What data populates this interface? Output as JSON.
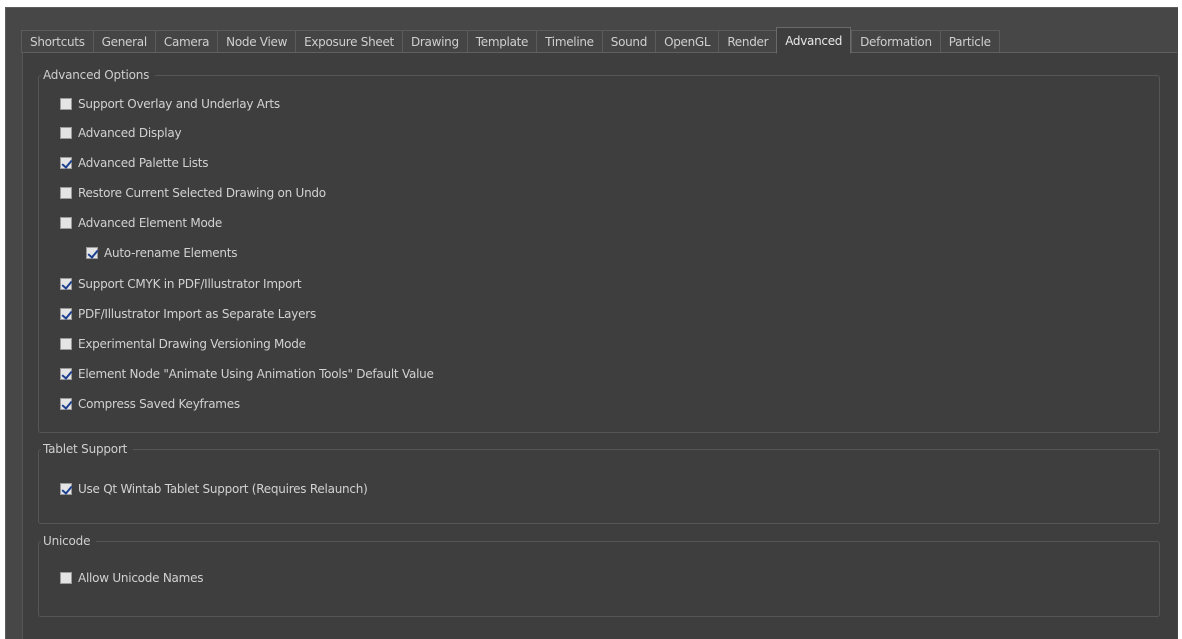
{
  "tabs": [
    {
      "label": "Shortcuts",
      "active": false
    },
    {
      "label": "General",
      "active": false
    },
    {
      "label": "Camera",
      "active": false
    },
    {
      "label": "Node View",
      "active": false
    },
    {
      "label": "Exposure Sheet",
      "active": false
    },
    {
      "label": "Drawing",
      "active": false
    },
    {
      "label": "Template",
      "active": false
    },
    {
      "label": "Timeline",
      "active": false
    },
    {
      "label": "Sound",
      "active": false
    },
    {
      "label": "OpenGL",
      "active": false
    },
    {
      "label": "Render",
      "active": false
    },
    {
      "label": "Advanced",
      "active": true
    },
    {
      "label": "Deformation",
      "active": false
    },
    {
      "label": "Particle",
      "active": false
    }
  ],
  "advanced_options": {
    "title": "Advanced Options",
    "items": [
      {
        "label": "Support Overlay and Underlay Arts",
        "checked": false
      },
      {
        "label": "Advanced Display",
        "checked": false
      },
      {
        "label": "Advanced Palette Lists",
        "checked": true
      },
      {
        "label": "Restore Current Selected Drawing on Undo",
        "checked": false
      },
      {
        "label": "Advanced Element Mode",
        "checked": false
      },
      {
        "label": "Auto-rename Elements",
        "checked": true
      },
      {
        "label": "Support CMYK in PDF/Illustrator Import",
        "checked": true
      },
      {
        "label": "PDF/Illustrator Import as Separate Layers",
        "checked": true
      },
      {
        "label": "Experimental Drawing Versioning Mode",
        "checked": false
      },
      {
        "label": "Element Node \"Animate Using Animation Tools\" Default Value",
        "checked": true
      },
      {
        "label": "Compress Saved Keyframes",
        "checked": true
      }
    ]
  },
  "tablet_support": {
    "title": "Tablet Support",
    "items": [
      {
        "label": "Use Qt Wintab Tablet Support (Requires Relaunch)",
        "checked": true
      }
    ]
  },
  "unicode": {
    "title": "Unicode",
    "items": [
      {
        "label": "Allow Unicode Names",
        "checked": false
      }
    ]
  },
  "colors": {
    "window_bg": "#474747",
    "panel_bg": "#3e3e3e",
    "text": "#d2d2d2",
    "check_mark": "#1c3f8f"
  }
}
